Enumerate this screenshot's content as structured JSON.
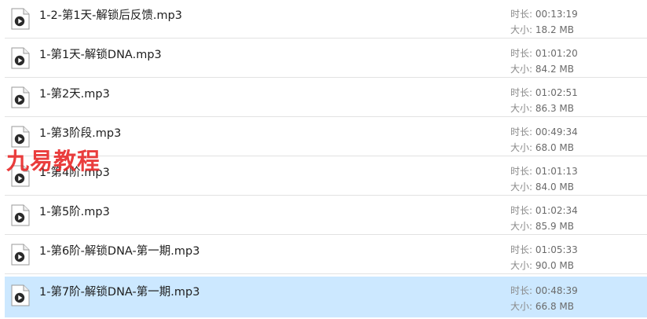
{
  "files": [
    {
      "name": "1-2-第1天-解锁后反馈.mp3",
      "duration_label": "时长:",
      "duration": "00:13:19",
      "size_label": "大小:",
      "size": "18.2 MB"
    },
    {
      "name": "1-第1天-解锁DNA.mp3",
      "duration_label": "时长:",
      "duration": "01:01:20",
      "size_label": "大小:",
      "size": "84.2 MB"
    },
    {
      "name": "1-第2天.mp3",
      "duration_label": "时长:",
      "duration": "01:02:51",
      "size_label": "大小:",
      "size": "86.3 MB"
    },
    {
      "name": "1-第3阶段.mp3",
      "duration_label": "时长:",
      "duration": "00:49:34",
      "size_label": "大小:",
      "size": "68.0 MB"
    },
    {
      "name": "1-第4阶.mp3",
      "duration_label": "时长:",
      "duration": "01:01:13",
      "size_label": "大小:",
      "size": "84.0 MB"
    },
    {
      "name": "1-第5阶.mp3",
      "duration_label": "时长:",
      "duration": "01:02:34",
      "size_label": "大小:",
      "size": "85.9 MB"
    },
    {
      "name": "1-第6阶-解锁DNA-第一期.mp3",
      "duration_label": "时长:",
      "duration": "01:05:33",
      "size_label": "大小:",
      "size": "90.0 MB"
    },
    {
      "name": "1-第7阶-解锁DNA-第一期.mp3",
      "duration_label": "时长:",
      "duration": "00:48:39",
      "size_label": "大小:",
      "size": "66.8 MB"
    }
  ],
  "selected_index": 7,
  "file_icon": "audio-file-icon",
  "watermark": "九易教程",
  "colors": {
    "selection": "#cce8ff",
    "divider": "#e2e2e2",
    "watermark": "#e82828"
  }
}
